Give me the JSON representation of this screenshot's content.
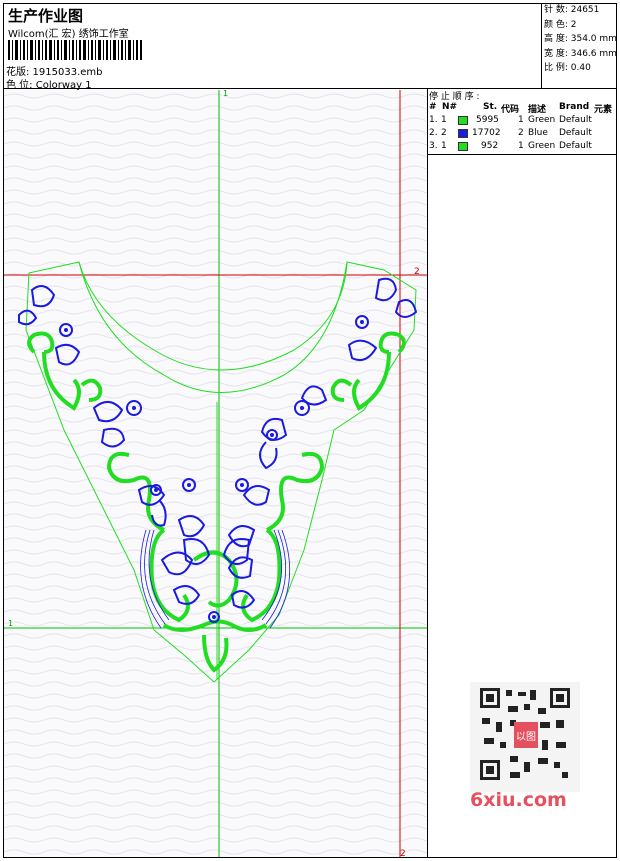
{
  "header": {
    "title": "生产作业图",
    "subtitle": "Wilcom(汇 宏) 绣饰工作室",
    "file_label": "花版: 1915033.emb",
    "color_label": "色 位:  Colorway 1"
  },
  "stats": [
    "针 数: 24651",
    "颜 色: 2",
    "高 度: 354.0 mm",
    "宽 度: 346.6 mm",
    "比 例: 0.40"
  ],
  "stop_sequence": {
    "title": "停 止 顺 序 :",
    "columns": [
      "#",
      "N#",
      "St.",
      "代码",
      "描述",
      "Brand",
      "元素"
    ],
    "rows": [
      {
        "idx": "1.",
        "n": "1",
        "color": "#22dd22",
        "st": "5995",
        "code": "1",
        "desc": "Green",
        "brand": "Default"
      },
      {
        "idx": "2.",
        "n": "2",
        "color": "#1a1ae0",
        "st": "17702",
        "code": "2",
        "desc": "Blue",
        "brand": "Default"
      },
      {
        "idx": "3.",
        "n": "1",
        "color": "#22dd22",
        "st": "952",
        "code": "1",
        "desc": "Green",
        "brand": "Default"
      }
    ]
  },
  "guides": {
    "v1": "1",
    "h2": "2",
    "h1": "1",
    "v2": "2"
  },
  "colors": {
    "green": "#22dd22",
    "blue": "#1a1ae0",
    "guide_green": "#00c000",
    "guide_red": "#cc0000"
  },
  "watermark": {
    "site": "6xiu.com",
    "stamp": "以图"
  }
}
